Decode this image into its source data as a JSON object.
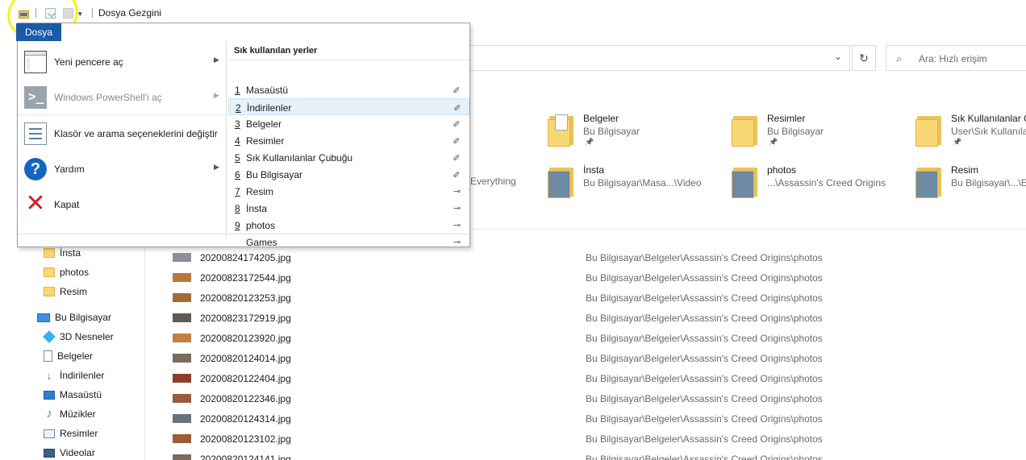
{
  "window": {
    "title": "Dosya Gezgini"
  },
  "ribbon": {
    "file_tab": "Dosya"
  },
  "file_menu": {
    "commands": [
      {
        "label": "Yeni pencere aç",
        "disabled": false,
        "has_submenu": true,
        "icon": "new-window-icon"
      },
      {
        "label": "Windows PowerShell'i aç",
        "disabled": true,
        "has_submenu": true,
        "icon": "powershell-icon"
      },
      {
        "label": "Klasör ve arama seçeneklerini değiştir",
        "disabled": false,
        "has_submenu": false,
        "icon": "folder-options-icon"
      },
      {
        "label": "Yardım",
        "disabled": false,
        "has_submenu": true,
        "icon": "help-icon"
      },
      {
        "label": "Kapat",
        "disabled": false,
        "has_submenu": false,
        "icon": "close-icon"
      }
    ],
    "recent_heading": "Sık kullanılan yerler",
    "recent_places": [
      {
        "num": "1",
        "label": "Masaüstü",
        "pinned": true
      },
      {
        "num": "2",
        "label": "İndirilenler",
        "pinned": true
      },
      {
        "num": "3",
        "label": "Belgeler",
        "pinned": true
      },
      {
        "num": "4",
        "label": "Resimler",
        "pinned": true
      },
      {
        "num": "5",
        "label": "Sık Kullanılanlar Çubuğu",
        "pinned": true
      },
      {
        "num": "6",
        "label": "Bu Bilgisayar",
        "pinned": true
      },
      {
        "num": "7",
        "label": "Resim",
        "pinned": false
      },
      {
        "num": "8",
        "label": "İnsta",
        "pinned": false
      },
      {
        "num": "9",
        "label": "photos",
        "pinned": false
      },
      {
        "num": "",
        "label": "Games",
        "pinned": false
      }
    ]
  },
  "search": {
    "placeholder": "Ara: Hızlı erişim"
  },
  "quick_access_tiles": [
    {
      "name": "Belgeler",
      "path": "Bu Bilgisayar",
      "pinned": true
    },
    {
      "name": "Resimler",
      "path": "Bu Bilgisayar",
      "pinned": true
    },
    {
      "name": "Sık Kullanılanlar Ç",
      "path": "User\\Sık Kullanıla",
      "pinned": true
    },
    {
      "name": "İnsta",
      "path": "Bu Bilgisayar\\Masa...\\Video",
      "pinned": false
    },
    {
      "name": "photos",
      "path": "...\\Assassin's Creed Origins",
      "pinned": false
    },
    {
      "name": "Resim",
      "path": "Bu Bilgisayar\\...\\E",
      "pinned": false
    }
  ],
  "partial_tile_text": "Everything",
  "nav_pane": {
    "items": [
      {
        "label": "İnsta",
        "icon": "folder-icon"
      },
      {
        "label": "photos",
        "icon": "folder-icon"
      },
      {
        "label": "Resim",
        "icon": "folder-icon"
      },
      {
        "label": "Bu Bilgisayar",
        "icon": "computer-icon"
      },
      {
        "label": "3D Nesneler",
        "icon": "3d-objects-icon"
      },
      {
        "label": "Belgeler",
        "icon": "documents-icon"
      },
      {
        "label": "İndirilenler",
        "icon": "downloads-icon"
      },
      {
        "label": "Masaüstü",
        "icon": "desktop-icon"
      },
      {
        "label": "Müzikler",
        "icon": "music-icon"
      },
      {
        "label": "Resimler",
        "icon": "pictures-icon"
      },
      {
        "label": "Videolar",
        "icon": "videos-icon"
      }
    ]
  },
  "recent_files": {
    "common_path": "Bu Bilgisayar\\Belgeler\\Assassin's Creed Origins\\photos",
    "rows": [
      {
        "name": "20200824174205.jpg",
        "thumb": "#8c8f93"
      },
      {
        "name": "20200823172544.jpg",
        "thumb": "#b8783c"
      },
      {
        "name": "20200820123253.jpg",
        "thumb": "#a56a3a"
      },
      {
        "name": "20200823172919.jpg",
        "thumb": "#5f5a55"
      },
      {
        "name": "20200820123920.jpg",
        "thumb": "#c08040"
      },
      {
        "name": "20200820124014.jpg",
        "thumb": "#7a6b5e"
      },
      {
        "name": "20200820122404.jpg",
        "thumb": "#8a3f2c"
      },
      {
        "name": "20200820122346.jpg",
        "thumb": "#9a5c3c"
      },
      {
        "name": "20200820124314.jpg",
        "thumb": "#6c7077"
      },
      {
        "name": "20200820123102.jpg",
        "thumb": "#a05b36"
      },
      {
        "name": "20200820124141.jpg",
        "thumb": "#7d6a58"
      }
    ]
  },
  "colors": {
    "file_tab_bg": "#1a5aa7",
    "highlight_circle": "#f5f50a",
    "hover_bg": "#e5f1fb"
  }
}
